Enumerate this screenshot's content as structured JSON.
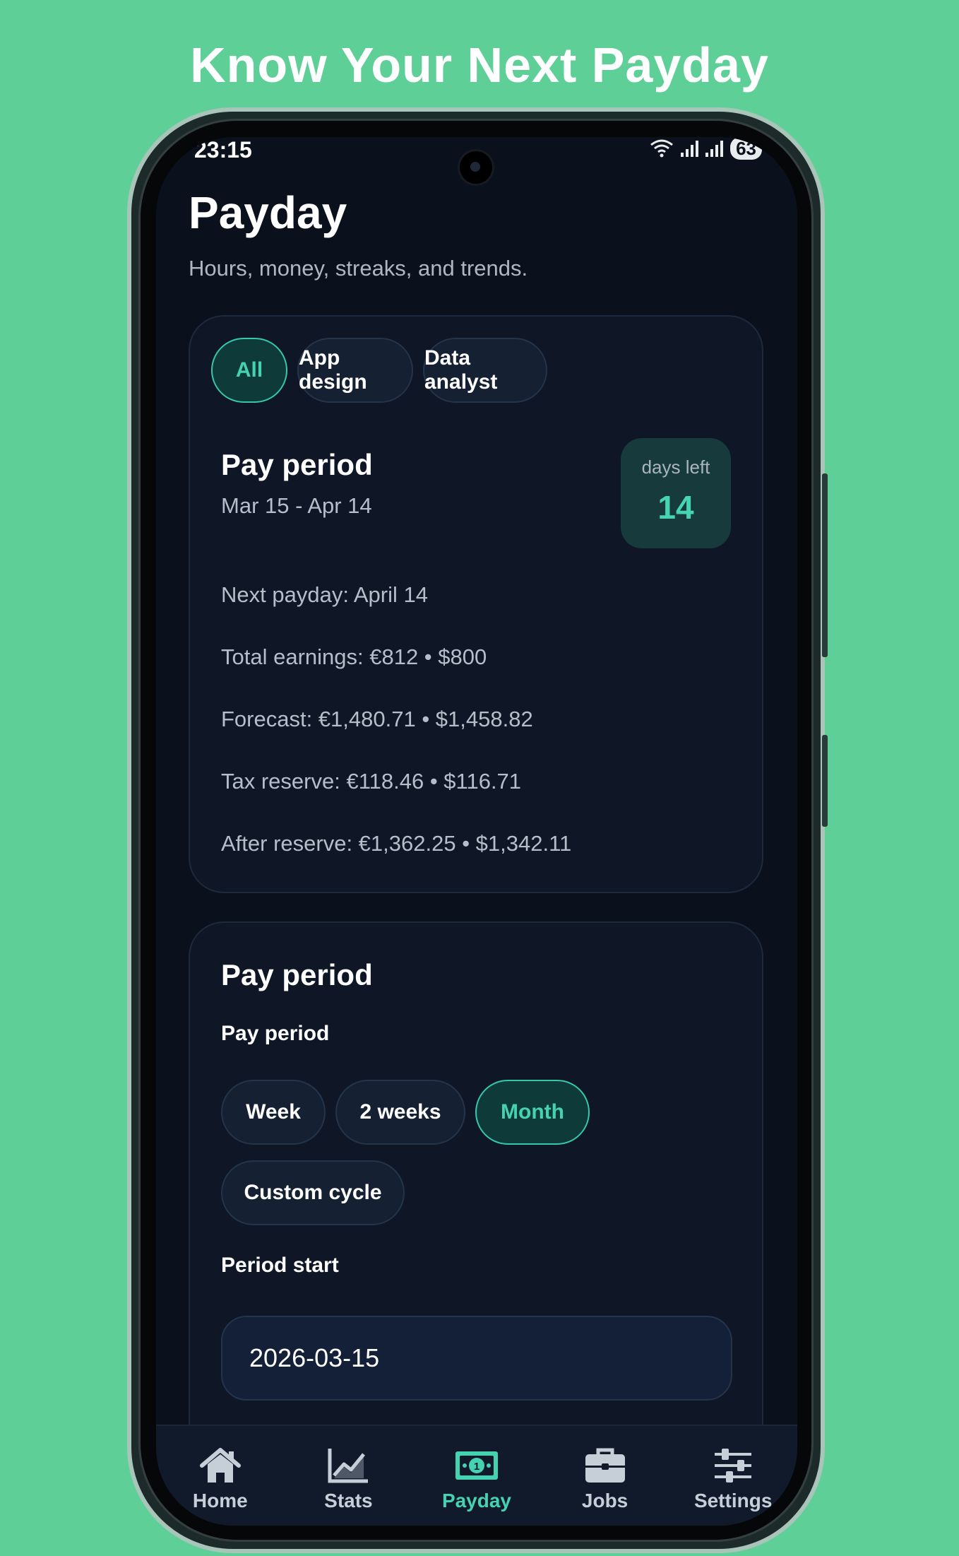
{
  "headline": "Know Your Next Payday",
  "status_bar": {
    "time": "23:15",
    "battery": "63"
  },
  "page": {
    "title": "Payday",
    "subtitle": "Hours, money, streaks, and trends."
  },
  "filters": [
    {
      "label": "All",
      "active": true
    },
    {
      "label": "App design",
      "active": false
    },
    {
      "label": "Data analyst",
      "active": false
    }
  ],
  "summary": {
    "title": "Pay period",
    "dates": "Mar 15 - Apr 14",
    "days_left_label": "days left",
    "days_left_value": "14",
    "next_payday": "Next payday: April 14",
    "total_earnings": "Total earnings: €812 • $800",
    "forecast": "Forecast: €1,480.71 • $1,458.82",
    "tax_reserve": "Tax reserve: €118.46 • $116.71",
    "after_reserve": "After reserve: €1,362.25 • $1,342.11"
  },
  "settings": {
    "title": "Pay period",
    "period_label": "Pay period",
    "options": [
      {
        "label": "Week",
        "active": false
      },
      {
        "label": "2 weeks",
        "active": false
      },
      {
        "label": "Month",
        "active": true
      },
      {
        "label": "Custom cycle",
        "active": false
      }
    ],
    "period_start_label": "Period start",
    "period_start_value": "2026-03-15"
  },
  "nav": [
    {
      "label": "Home",
      "icon": "home-icon",
      "active": false
    },
    {
      "label": "Stats",
      "icon": "chart-icon",
      "active": false
    },
    {
      "label": "Payday",
      "icon": "money-icon",
      "active": true
    },
    {
      "label": "Jobs",
      "icon": "briefcase-icon",
      "active": false
    },
    {
      "label": "Settings",
      "icon": "sliders-icon",
      "active": false
    }
  ],
  "colors": {
    "background": "#5fcf98",
    "screen": "#0b111c",
    "card": "#0f1726",
    "accent": "#44d2b1"
  }
}
